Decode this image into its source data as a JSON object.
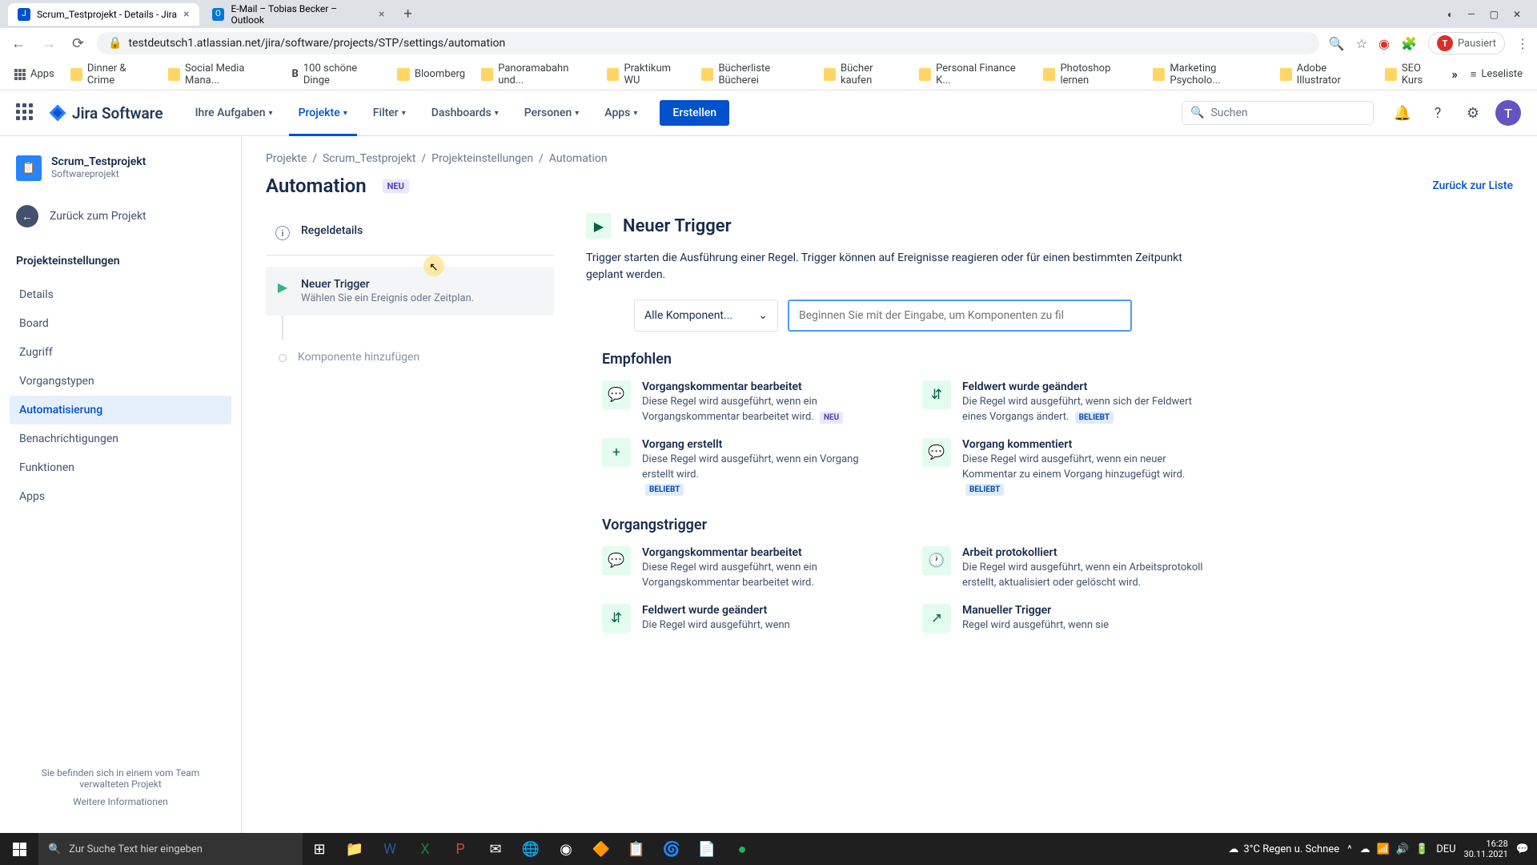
{
  "browser": {
    "tabs": [
      {
        "title": "Scrum_Testprojekt - Details - Jira",
        "favicon": "J"
      },
      {
        "title": "E-Mail – Tobias Becker – Outlook",
        "favicon": "O"
      }
    ],
    "url": "testdeutsch1.atlassian.net/jira/software/projects/STP/settings/automation",
    "profile_status": "Pausiert",
    "profile_initial": "T",
    "bookmarks": [
      "Apps",
      "Dinner & Crime",
      "Social Media Mana...",
      "100 schöne Dinge",
      "Bloomberg",
      "Panoramabahn und...",
      "Praktikum WU",
      "Bücherliste Bücherei",
      "Bücher kaufen",
      "Personal Finance K...",
      "Photoshop lernen",
      "Marketing Psycholo...",
      "Adobe Illustrator",
      "SEO Kurs"
    ],
    "reading_list": "Leseliste"
  },
  "topnav": {
    "logo": "Jira Software",
    "items": [
      "Ihre Aufgaben",
      "Projekte",
      "Filter",
      "Dashboards",
      "Personen",
      "Apps"
    ],
    "create": "Erstellen",
    "search_placeholder": "Suchen",
    "avatar": "T"
  },
  "sidebar": {
    "project_name": "Scrum_Testprojekt",
    "project_type": "Softwareprojekt",
    "back": "Zurück zum Projekt",
    "heading": "Projekteinstellungen",
    "items": [
      "Details",
      "Board",
      "Zugriff",
      "Vorgangstypen",
      "Automatisierung",
      "Benachrichtigungen",
      "Funktionen",
      "Apps"
    ],
    "footer_text": "Sie befinden sich in einem vom Team verwalteten Projekt",
    "footer_link": "Weitere Informationen"
  },
  "breadcrumb": [
    "Projekte",
    "Scrum_Testprojekt",
    "Projekteinstellungen",
    "Automation"
  ],
  "page": {
    "title": "Automation",
    "badge": "NEU",
    "back_to_list": "Zurück zur Liste"
  },
  "steps": {
    "rule_details": "Regeldetails",
    "trigger_title": "Neuer Trigger",
    "trigger_sub": "Wählen Sie ein Ereignis oder Zeitplan.",
    "add_component": "Komponente hinzufügen"
  },
  "detail": {
    "title": "Neuer Trigger",
    "description": "Trigger starten die Ausführung einer Regel. Trigger können auf Ereignisse reagieren oder für einen bestimmten Zeitpunkt geplant werden.",
    "filter_label": "Alle Komponent...",
    "filter_placeholder": "Beginnen Sie mit der Eingabe, um Komponenten zu fil"
  },
  "sections": {
    "recommended": "Empfohlen",
    "issue_triggers": "Vorgangstrigger"
  },
  "triggers": {
    "rec": [
      {
        "title": "Vorgangskommentar bearbeitet",
        "desc": "Diese Regel wird ausgeführt, wenn ein Vorgangskommentar bearbeitet wird.",
        "badge": "NEU",
        "icon": "💬"
      },
      {
        "title": "Feldwert wurde geändert",
        "desc": "Die Regel wird ausgeführt, wenn sich der Feldwert eines Vorgangs ändert.",
        "badge": "BELIEBT",
        "icon": "⇵"
      },
      {
        "title": "Vorgang erstellt",
        "desc": "Diese Regel wird ausgeführt, wenn ein Vorgang erstellt wird.",
        "badge": "BELIEBT",
        "icon": "+"
      },
      {
        "title": "Vorgang kommentiert",
        "desc": "Diese Regel wird ausgeführt, wenn ein neuer Kommentar zu einem Vorgang hinzugefügt wird.",
        "badge": "BELIEBT",
        "icon": "💬"
      }
    ],
    "issue": [
      {
        "title": "Vorgangskommentar bearbeitet",
        "desc": "Diese Regel wird ausgeführt, wenn ein Vorgangskommentar bearbeitet wird.",
        "icon": "💬"
      },
      {
        "title": "Arbeit protokolliert",
        "desc": "Die Regel wird ausgeführt, wenn ein Arbeitsprotokoll erstellt, aktualisiert oder gelöscht wird.",
        "icon": "🕐"
      },
      {
        "title": "Feldwert wurde geändert",
        "desc": "Die Regel wird ausgeführt, wenn",
        "icon": "⇵"
      },
      {
        "title": "Manueller Trigger",
        "desc": "Regel wird ausgeführt, wenn sie",
        "icon": "↗"
      }
    ]
  },
  "taskbar": {
    "search": "Zur Suche Text hier eingeben",
    "weather": "3°C  Regen u. Schnee",
    "lang": "DEU",
    "time": "16:28",
    "date": "30.11.2021"
  }
}
